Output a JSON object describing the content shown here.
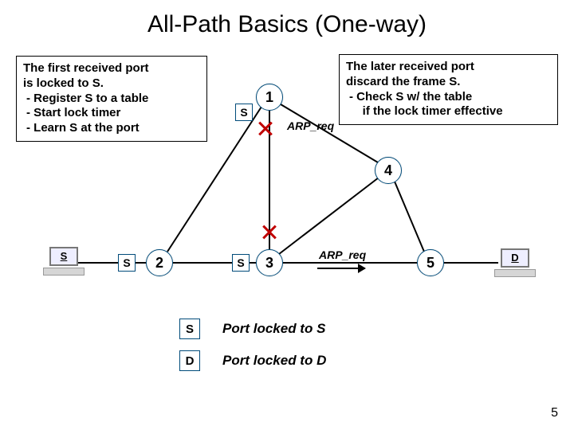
{
  "title": "All-Path Basics (One-way)",
  "callout_left": {
    "l1": "The first received port",
    "l2": "is locked to S.",
    "b1": "-   Register S to a table",
    "b2": "-   Start lock timer",
    "b3": "-   Learn S at the port"
  },
  "callout_right": {
    "l1": "The later received port",
    "l2": "discard the frame S.",
    "b1": "-   Check S w/ the table",
    "b2": "    if the lock timer effective"
  },
  "nodes": {
    "n1": "1",
    "n2": "2",
    "n3": "3",
    "n4": "4",
    "n5": "5"
  },
  "labels": {
    "s": "S",
    "d": "D",
    "arp": "ARP_req"
  },
  "legend": {
    "s_text": "Port locked to S",
    "d_text": "Port locked to D"
  },
  "hosts": {
    "src_label": "S",
    "dst_label": "D"
  },
  "page_number": "5"
}
